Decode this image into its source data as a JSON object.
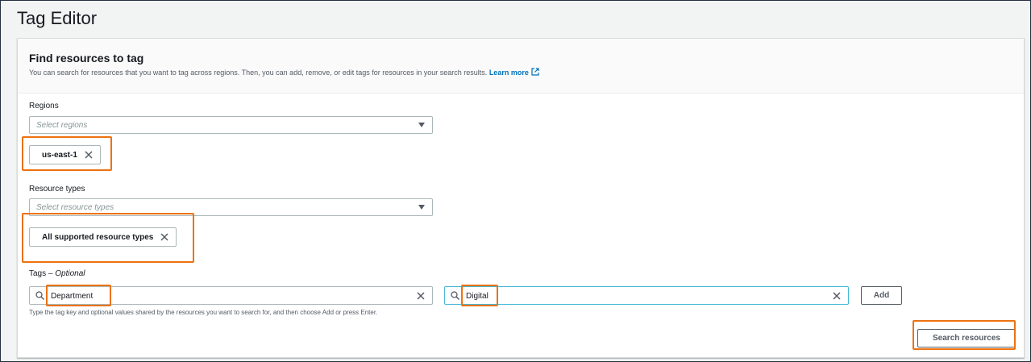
{
  "page": {
    "title": "Tag Editor"
  },
  "panel": {
    "title": "Find resources to tag",
    "description": "You can search for resources that you want to tag across regions. Then, you can add, remove, or edit tags for resources in your search results.",
    "learn_more": "Learn more"
  },
  "regions": {
    "label": "Regions",
    "placeholder": "Select regions",
    "selected_token": "us-east-1"
  },
  "resource_types": {
    "label": "Resource types",
    "placeholder": "Select resource types",
    "selected_token": "All supported resource types"
  },
  "tags": {
    "label": "Tags –",
    "label_optional": "Optional",
    "key_value": "Department",
    "value_value": "Digital",
    "add_label": "Add",
    "hint": "Type the tag key and optional values shared by the resources you want to search for, and then choose Add or press Enter."
  },
  "actions": {
    "search_label": "Search resources"
  },
  "colors": {
    "highlight": "#ec7211",
    "link": "#0073bb",
    "focus": "#44b9d6"
  }
}
